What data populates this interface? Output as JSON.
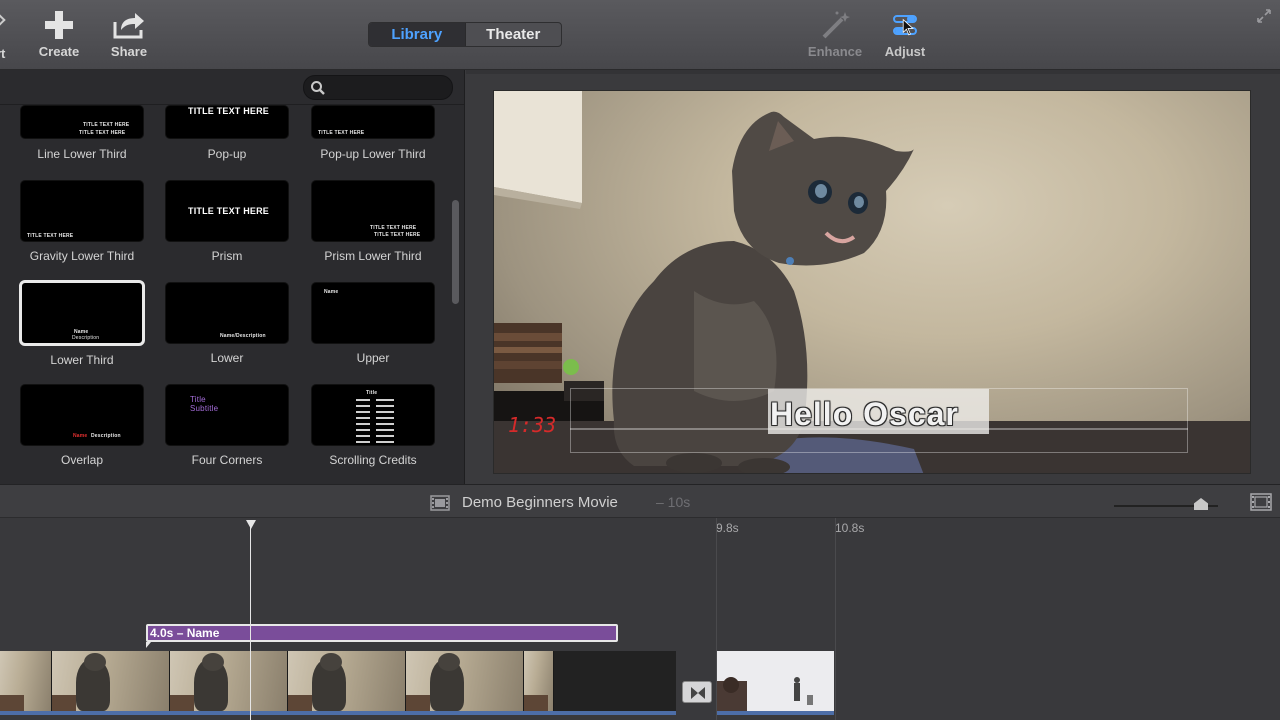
{
  "toolbar": {
    "edge_label": "rt",
    "create_label": "Create",
    "share_label": "Share",
    "library_tab": "Library",
    "theater_tab": "Theater",
    "enhance_label": "Enhance",
    "adjust_label": "Adjust",
    "icons": [
      "plus-icon",
      "share-icon",
      "magic-wand-icon",
      "sliders-icon",
      "fullscreen-icon"
    ]
  },
  "browser": {
    "search_placeholder": "",
    "tiles": [
      {
        "name": "Line Lower Third",
        "preview": [
          "TITLE TEXT HERE",
          "TITLE TEXT HERE"
        ]
      },
      {
        "name": "Pop-up",
        "preview": [
          "TITLE TEXT HERE"
        ]
      },
      {
        "name": "Pop-up Lower Third",
        "preview": [
          "TITLE TEXT HERE"
        ]
      },
      {
        "name": "Gravity Lower Third",
        "preview": [
          "TITLE TEXT HERE"
        ]
      },
      {
        "name": "Prism",
        "preview": [
          "TITLE TEXT HERE"
        ]
      },
      {
        "name": "Prism Lower Third",
        "preview": [
          "TITLE TEXT HERE",
          "TITLE TEXT HERE"
        ]
      },
      {
        "name": "Lower Third",
        "preview": [
          "Name",
          "Description"
        ],
        "selected": true
      },
      {
        "name": "Lower",
        "preview": [
          "Name/Description"
        ]
      },
      {
        "name": "Upper",
        "preview": [
          "Name"
        ]
      },
      {
        "name": "Overlap",
        "preview": [
          "Name",
          "Description"
        ]
      },
      {
        "name": "Four Corners",
        "preview": [
          "Title",
          "Subtitle"
        ]
      },
      {
        "name": "Scrolling Credits",
        "preview": [
          "Title"
        ]
      }
    ]
  },
  "viewer": {
    "title_text": "Hello Oscar",
    "clock_text": "1:33"
  },
  "timeline": {
    "project_title": "Demo Beginners Movie",
    "project_duration": "– 10s",
    "marker_1": "9.8s",
    "marker_2": "10.8s",
    "title_clip_label": "4.0s – Name"
  },
  "colors": {
    "accent": "#4ea2ff",
    "title_clip": "#7a4d9a",
    "video_track": "#4d6ea8"
  }
}
